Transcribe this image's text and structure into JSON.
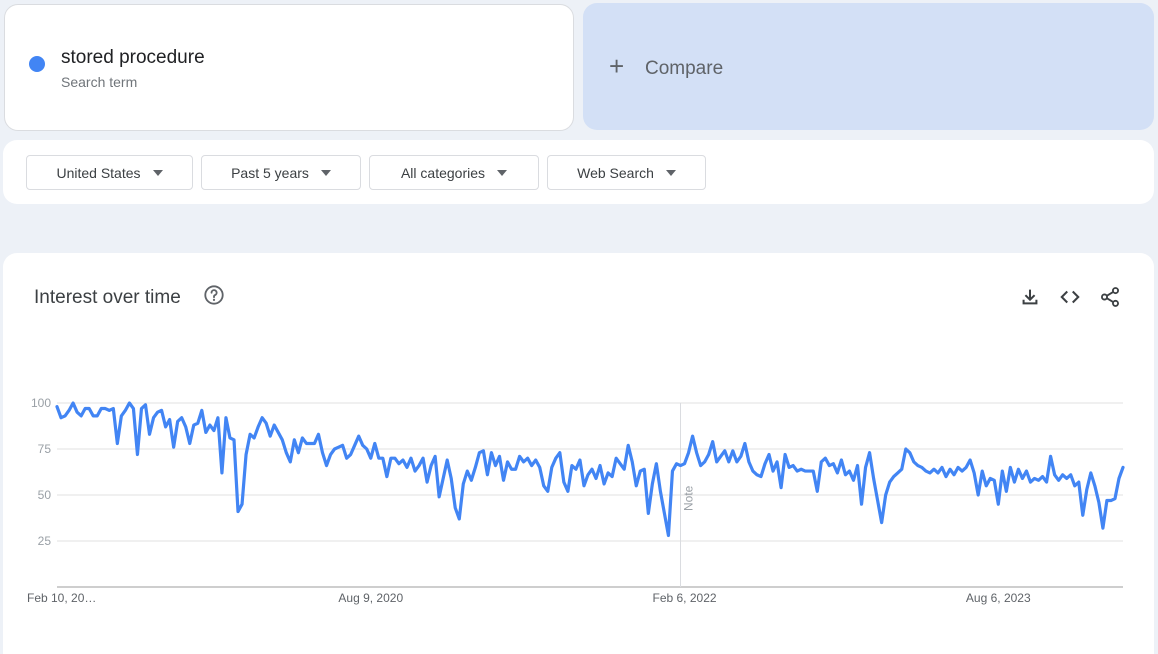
{
  "search_term": {
    "name": "stored procedure",
    "subtitle": "Search term",
    "color": "#4285f4"
  },
  "compare": {
    "label": "Compare",
    "icon": "plus-icon"
  },
  "filters": [
    {
      "label": "United States",
      "icon": "caret-down-icon"
    },
    {
      "label": "Past 5 years",
      "icon": "caret-down-icon"
    },
    {
      "label": "All categories",
      "icon": "caret-down-icon"
    },
    {
      "label": "Web Search",
      "icon": "caret-down-icon"
    }
  ],
  "panel": {
    "title": "Interest over time",
    "help_icon": "help-circle-icon",
    "tools": [
      "download-icon",
      "embed-code-icon",
      "share-icon"
    ]
  },
  "chart_data": {
    "type": "line",
    "title": "Interest over time",
    "xlabel": "",
    "ylabel": "",
    "ylim": [
      0,
      100
    ],
    "y_ticks": [
      "100",
      "75",
      "50",
      "25"
    ],
    "x_ticks": [
      {
        "label": "Feb 10, 20…",
        "index": 0
      },
      {
        "label": "Aug 9, 2020",
        "index": 78
      },
      {
        "label": "Feb 6, 2022",
        "index": 156
      },
      {
        "label": "Aug 6, 2023",
        "index": 234
      }
    ],
    "note": {
      "label": "Note",
      "index": 155
    },
    "grid": true,
    "legend": "none",
    "series": [
      {
        "name": "stored procedure",
        "color": "#4285f4",
        "values": [
          98,
          92,
          93,
          96,
          100,
          95,
          93,
          97,
          97,
          93,
          93,
          97,
          97,
          96,
          97,
          78,
          93,
          96,
          100,
          97,
          72,
          97,
          99,
          83,
          92,
          95,
          96,
          87,
          91,
          76,
          90,
          92,
          87,
          78,
          88,
          89,
          96,
          84,
          88,
          85,
          92,
          62,
          92,
          81,
          80,
          41,
          45,
          72,
          83,
          81,
          87,
          92,
          89,
          82,
          88,
          84,
          80,
          73,
          68,
          80,
          73,
          81,
          78,
          78,
          78,
          83,
          73,
          66,
          72,
          75,
          76,
          77,
          70,
          72,
          77,
          82,
          77,
          75,
          70,
          78,
          70,
          70,
          60,
          70,
          70,
          67,
          69,
          65,
          70,
          63,
          66,
          70,
          57,
          66,
          71,
          49,
          59,
          69,
          59,
          43,
          37,
          56,
          63,
          58,
          65,
          73,
          74,
          61,
          73,
          66,
          71,
          58,
          68,
          64,
          64,
          71,
          68,
          70,
          66,
          69,
          65,
          55,
          52,
          65,
          70,
          73,
          57,
          52,
          66,
          64,
          69,
          55,
          61,
          64,
          59,
          66,
          56,
          62,
          60,
          70,
          67,
          64,
          77,
          68,
          55,
          63,
          64,
          40,
          56,
          67,
          52,
          40,
          28,
          63,
          67,
          66,
          67,
          73,
          82,
          73,
          66,
          68,
          72,
          79,
          68,
          71,
          74,
          68,
          74,
          68,
          71,
          78,
          68,
          63,
          61,
          60,
          67,
          72,
          63,
          68,
          54,
          72,
          65,
          66,
          63,
          64,
          63,
          63,
          63,
          52,
          68,
          70,
          66,
          67,
          62,
          69,
          61,
          63,
          58,
          66,
          45,
          65,
          73,
          59,
          47,
          35,
          50,
          57,
          60,
          62,
          64,
          75,
          73,
          68,
          66,
          65,
          63,
          62,
          64,
          62,
          65,
          60,
          64,
          61,
          65,
          63,
          65,
          69,
          62,
          50,
          63,
          55,
          59,
          58,
          45,
          63,
          52,
          65,
          57,
          64,
          59,
          63,
          57,
          59,
          58,
          60,
          57,
          71,
          61,
          58,
          61,
          59,
          61,
          55,
          57,
          39,
          53,
          62,
          55,
          46,
          32,
          47,
          47,
          48,
          59,
          65
        ]
      }
    ]
  }
}
